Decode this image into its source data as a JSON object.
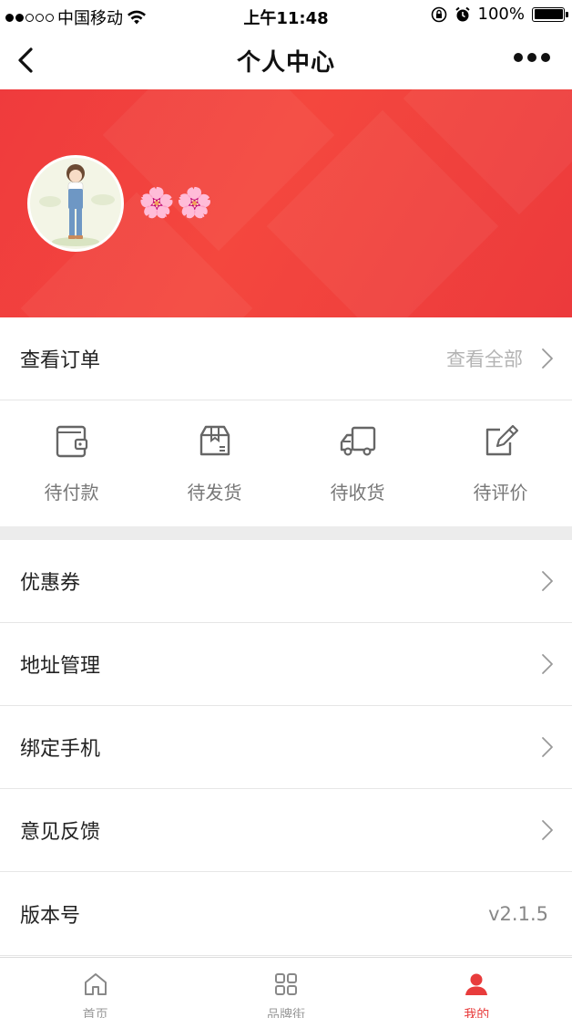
{
  "status_bar": {
    "carrier": "中国移动",
    "time": "上午11:48",
    "battery": "100%",
    "signal_strength": "2 of 5 dots",
    "icons": [
      "wifi-icon",
      "lock-rotation-icon",
      "alarm-icon",
      "battery-icon"
    ]
  },
  "nav": {
    "title": "个人中心",
    "back_icon": "chevron-left-icon",
    "more_icon": "more-dots-icon"
  },
  "profile": {
    "nickname": "🌸🌸",
    "avatar_icon": "avatar-girl-illustration"
  },
  "orders": {
    "label": "查看订单",
    "view_all": "查看全部",
    "statuses": [
      {
        "label": "待付款",
        "icon": "wallet-icon"
      },
      {
        "label": "待发货",
        "icon": "package-box-icon"
      },
      {
        "label": "待收货",
        "icon": "delivery-truck-icon"
      },
      {
        "label": "待评价",
        "icon": "edit-review-icon"
      }
    ]
  },
  "menu": [
    {
      "label": "优惠券"
    },
    {
      "label": "地址管理"
    },
    {
      "label": "绑定手机"
    },
    {
      "label": "意见反馈"
    }
  ],
  "version": {
    "label": "版本号",
    "value": "v2.1.5"
  },
  "tabs": [
    {
      "label": "首页",
      "icon": "home-icon"
    },
    {
      "label": "品牌街",
      "icon": "grid-icon"
    },
    {
      "label": "我的",
      "icon": "user-icon",
      "active": true
    }
  ],
  "colors": {
    "brand_red": "#e83c3c",
    "banner_red": "#f4473e",
    "muted_text": "#b3b3b3"
  }
}
